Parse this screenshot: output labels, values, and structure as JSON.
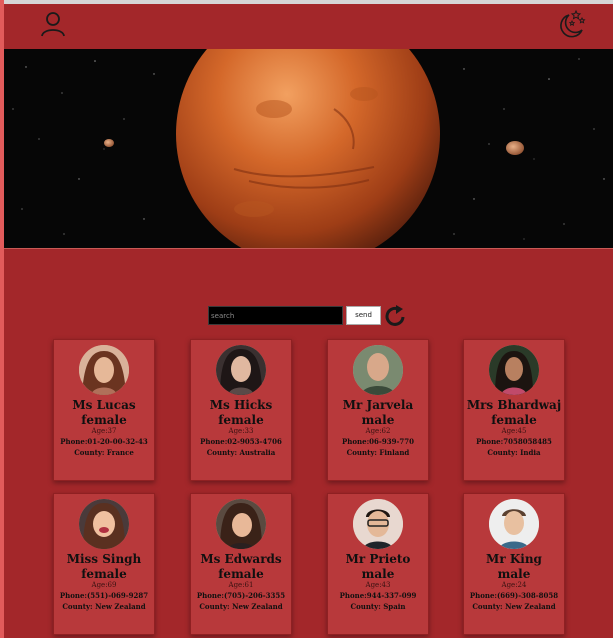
{
  "header": {
    "user_icon": "user-icon",
    "theme_icon": "moon-stars-icon"
  },
  "hero": {
    "image": "planet-mars-in-space"
  },
  "search": {
    "placeholder": "search",
    "value": "",
    "send_label": "send",
    "refresh_icon": "refresh-icon"
  },
  "colors": {
    "background": "#a3272a",
    "card": "#b8393b",
    "search_field": "#000000"
  },
  "people": [
    {
      "name": "Ms Lucas",
      "gender": "female",
      "age": "Age:37",
      "phone": "Phone:01-20-00-32-43",
      "county": "County: France"
    },
    {
      "name": "Ms Hicks",
      "gender": "female",
      "age": "Age:33",
      "phone": "Phone:02-9053-4706",
      "county": "County: Australia"
    },
    {
      "name": "Mr Jarvela",
      "gender": "male",
      "age": "Age:62",
      "phone": "Phone:06-939-770",
      "county": "County: Finland"
    },
    {
      "name": "Mrs Bhardwaj",
      "gender": "female",
      "age": "Age:45",
      "phone": "Phone:7058058485",
      "county": "County: India"
    },
    {
      "name": "Miss Singh",
      "gender": "female",
      "age": "Age:69",
      "phone": "Phone:(551)-069-9287",
      "county": "County: New Zealand"
    },
    {
      "name": "Ms Edwards",
      "gender": "female",
      "age": "Age:61",
      "phone": "Phone:(705)-206-3355",
      "county": "County: New Zealand"
    },
    {
      "name": "Mr Prieto",
      "gender": "male",
      "age": "Age:43",
      "phone": "Phone:944-337-099",
      "county": "County: Spain"
    },
    {
      "name": "Mr King",
      "gender": "male",
      "age": "Age:24",
      "phone": "Phone:(669)-308-8058",
      "county": "County: New Zealand"
    }
  ]
}
